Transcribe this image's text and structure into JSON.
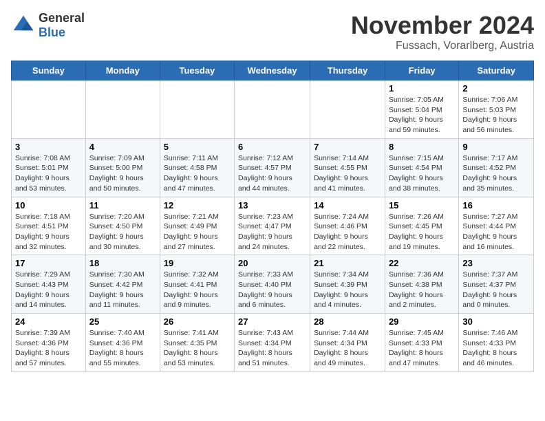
{
  "header": {
    "logo_line1": "General",
    "logo_line2": "Blue",
    "month_title": "November 2024",
    "subtitle": "Fussach, Vorarlberg, Austria"
  },
  "weekdays": [
    "Sunday",
    "Monday",
    "Tuesday",
    "Wednesday",
    "Thursday",
    "Friday",
    "Saturday"
  ],
  "weeks": [
    [
      {
        "day": "",
        "info": ""
      },
      {
        "day": "",
        "info": ""
      },
      {
        "day": "",
        "info": ""
      },
      {
        "day": "",
        "info": ""
      },
      {
        "day": "",
        "info": ""
      },
      {
        "day": "1",
        "info": "Sunrise: 7:05 AM\nSunset: 5:04 PM\nDaylight: 9 hours and 59 minutes."
      },
      {
        "day": "2",
        "info": "Sunrise: 7:06 AM\nSunset: 5:03 PM\nDaylight: 9 hours and 56 minutes."
      }
    ],
    [
      {
        "day": "3",
        "info": "Sunrise: 7:08 AM\nSunset: 5:01 PM\nDaylight: 9 hours and 53 minutes."
      },
      {
        "day": "4",
        "info": "Sunrise: 7:09 AM\nSunset: 5:00 PM\nDaylight: 9 hours and 50 minutes."
      },
      {
        "day": "5",
        "info": "Sunrise: 7:11 AM\nSunset: 4:58 PM\nDaylight: 9 hours and 47 minutes."
      },
      {
        "day": "6",
        "info": "Sunrise: 7:12 AM\nSunset: 4:57 PM\nDaylight: 9 hours and 44 minutes."
      },
      {
        "day": "7",
        "info": "Sunrise: 7:14 AM\nSunset: 4:55 PM\nDaylight: 9 hours and 41 minutes."
      },
      {
        "day": "8",
        "info": "Sunrise: 7:15 AM\nSunset: 4:54 PM\nDaylight: 9 hours and 38 minutes."
      },
      {
        "day": "9",
        "info": "Sunrise: 7:17 AM\nSunset: 4:52 PM\nDaylight: 9 hours and 35 minutes."
      }
    ],
    [
      {
        "day": "10",
        "info": "Sunrise: 7:18 AM\nSunset: 4:51 PM\nDaylight: 9 hours and 32 minutes."
      },
      {
        "day": "11",
        "info": "Sunrise: 7:20 AM\nSunset: 4:50 PM\nDaylight: 9 hours and 30 minutes."
      },
      {
        "day": "12",
        "info": "Sunrise: 7:21 AM\nSunset: 4:49 PM\nDaylight: 9 hours and 27 minutes."
      },
      {
        "day": "13",
        "info": "Sunrise: 7:23 AM\nSunset: 4:47 PM\nDaylight: 9 hours and 24 minutes."
      },
      {
        "day": "14",
        "info": "Sunrise: 7:24 AM\nSunset: 4:46 PM\nDaylight: 9 hours and 22 minutes."
      },
      {
        "day": "15",
        "info": "Sunrise: 7:26 AM\nSunset: 4:45 PM\nDaylight: 9 hours and 19 minutes."
      },
      {
        "day": "16",
        "info": "Sunrise: 7:27 AM\nSunset: 4:44 PM\nDaylight: 9 hours and 16 minutes."
      }
    ],
    [
      {
        "day": "17",
        "info": "Sunrise: 7:29 AM\nSunset: 4:43 PM\nDaylight: 9 hours and 14 minutes."
      },
      {
        "day": "18",
        "info": "Sunrise: 7:30 AM\nSunset: 4:42 PM\nDaylight: 9 hours and 11 minutes."
      },
      {
        "day": "19",
        "info": "Sunrise: 7:32 AM\nSunset: 4:41 PM\nDaylight: 9 hours and 9 minutes."
      },
      {
        "day": "20",
        "info": "Sunrise: 7:33 AM\nSunset: 4:40 PM\nDaylight: 9 hours and 6 minutes."
      },
      {
        "day": "21",
        "info": "Sunrise: 7:34 AM\nSunset: 4:39 PM\nDaylight: 9 hours and 4 minutes."
      },
      {
        "day": "22",
        "info": "Sunrise: 7:36 AM\nSunset: 4:38 PM\nDaylight: 9 hours and 2 minutes."
      },
      {
        "day": "23",
        "info": "Sunrise: 7:37 AM\nSunset: 4:37 PM\nDaylight: 9 hours and 0 minutes."
      }
    ],
    [
      {
        "day": "24",
        "info": "Sunrise: 7:39 AM\nSunset: 4:36 PM\nDaylight: 8 hours and 57 minutes."
      },
      {
        "day": "25",
        "info": "Sunrise: 7:40 AM\nSunset: 4:36 PM\nDaylight: 8 hours and 55 minutes."
      },
      {
        "day": "26",
        "info": "Sunrise: 7:41 AM\nSunset: 4:35 PM\nDaylight: 8 hours and 53 minutes."
      },
      {
        "day": "27",
        "info": "Sunrise: 7:43 AM\nSunset: 4:34 PM\nDaylight: 8 hours and 51 minutes."
      },
      {
        "day": "28",
        "info": "Sunrise: 7:44 AM\nSunset: 4:34 PM\nDaylight: 8 hours and 49 minutes."
      },
      {
        "day": "29",
        "info": "Sunrise: 7:45 AM\nSunset: 4:33 PM\nDaylight: 8 hours and 47 minutes."
      },
      {
        "day": "30",
        "info": "Sunrise: 7:46 AM\nSunset: 4:33 PM\nDaylight: 8 hours and 46 minutes."
      }
    ]
  ]
}
